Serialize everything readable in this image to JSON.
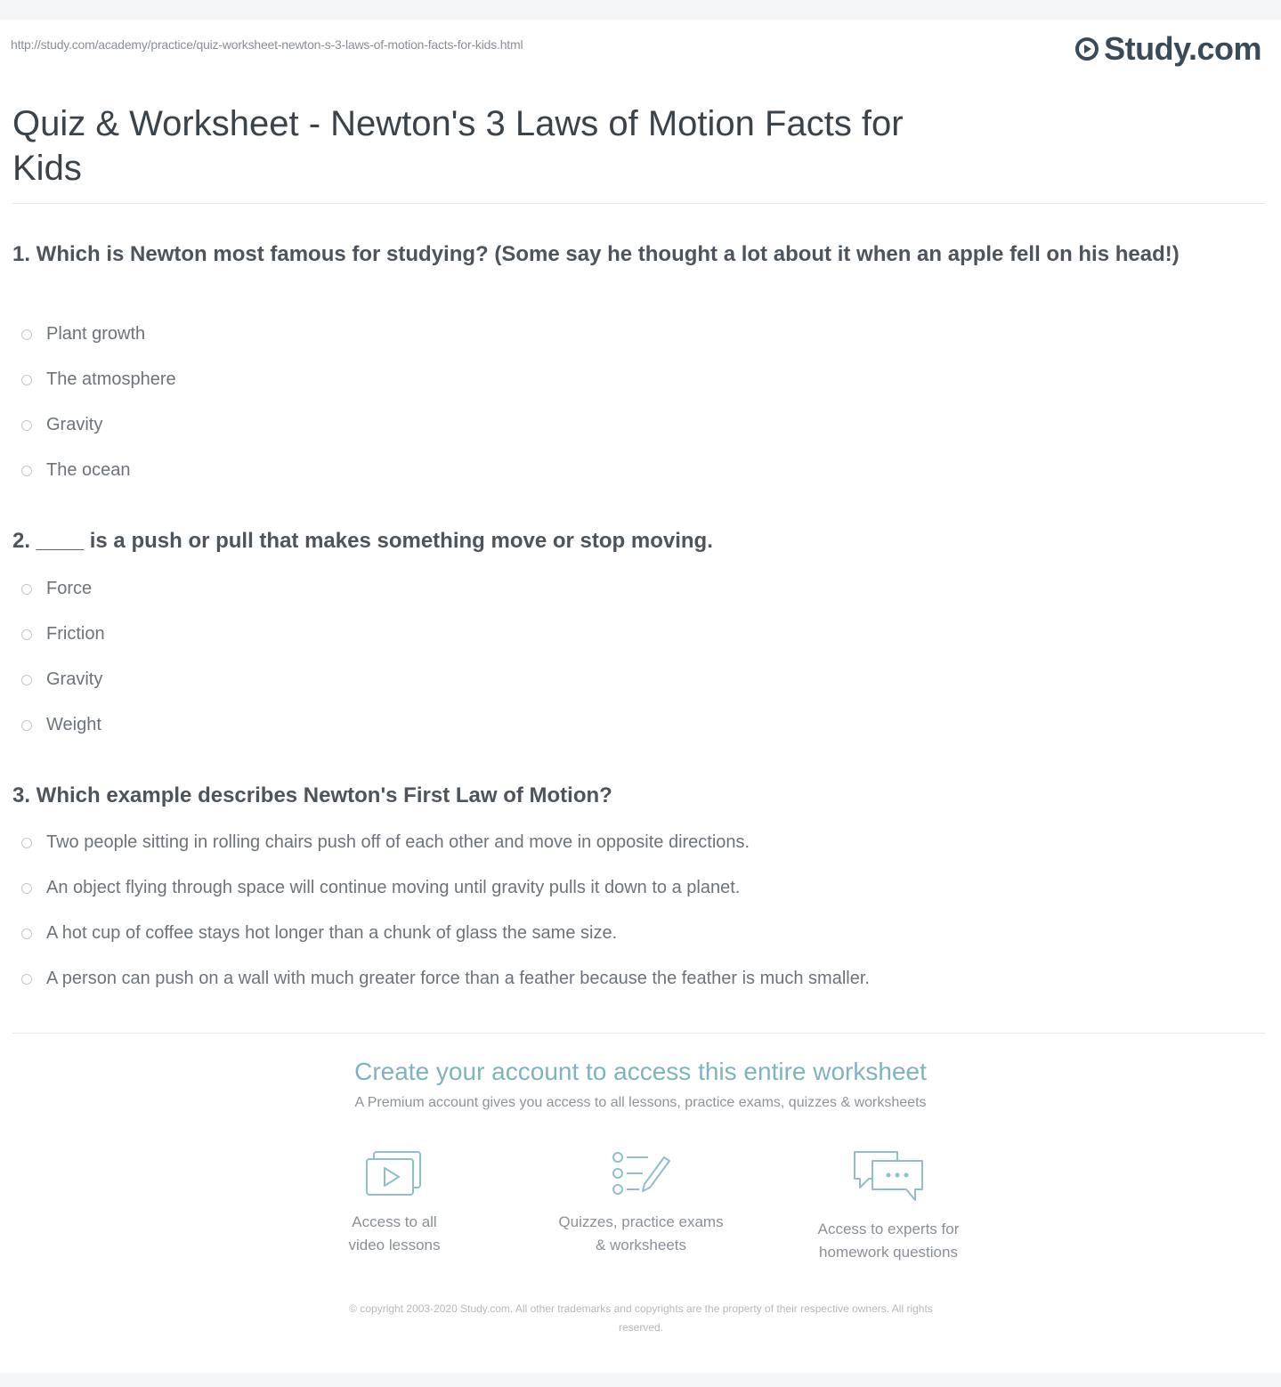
{
  "header": {
    "url": "http://study.com/academy/practice/quiz-worksheet-newton-s-3-laws-of-motion-facts-for-kids.html",
    "logo_text": "Study.com"
  },
  "title": "Quiz & Worksheet - Newton's 3 Laws of Motion Facts for Kids",
  "questions": [
    {
      "text": "1. Which is Newton most famous for studying? (Some say he thought a lot about it when an apple fell on his head!)",
      "options": [
        "Plant growth",
        "The atmosphere",
        "Gravity",
        "The ocean"
      ]
    },
    {
      "text": "2. ____ is a push or pull that makes something move or stop moving.",
      "options": [
        "Force",
        "Friction",
        "Gravity",
        "Weight"
      ]
    },
    {
      "text": "3. Which example describes Newton's First Law of Motion?",
      "options": [
        "Two people sitting in rolling chairs push off of each other and move in opposite directions.",
        "An object flying through space will continue moving until gravity pulls it down to a planet.",
        "A hot cup of coffee stays hot longer than a chunk of glass the same size.",
        "A person can push on a wall with much greater force than a feather because the feather is much smaller."
      ]
    }
  ],
  "cta": {
    "title": "Create your account to access this entire worksheet",
    "subtitle": "A Premium account gives you access to all lessons, practice exams, quizzes & worksheets",
    "features": [
      {
        "icon": "video-lessons-icon",
        "label_line1": "Access to all",
        "label_line2": "video lessons"
      },
      {
        "icon": "quizzes-icon",
        "label_line1": "Quizzes, practice exams",
        "label_line2": "& worksheets"
      },
      {
        "icon": "chat-experts-icon",
        "label_line1": "Access to experts for",
        "label_line2": "homework questions"
      }
    ]
  },
  "footer": {
    "copyright_line1": "© copyright 2003-2020 Study.com. All other trademarks and copyrights are the property of their respective owners. All rights",
    "copyright_line2": "reserved."
  },
  "colors": {
    "accent": "#7fb3bf",
    "title": "#3a424a",
    "text": "#4d545b"
  }
}
